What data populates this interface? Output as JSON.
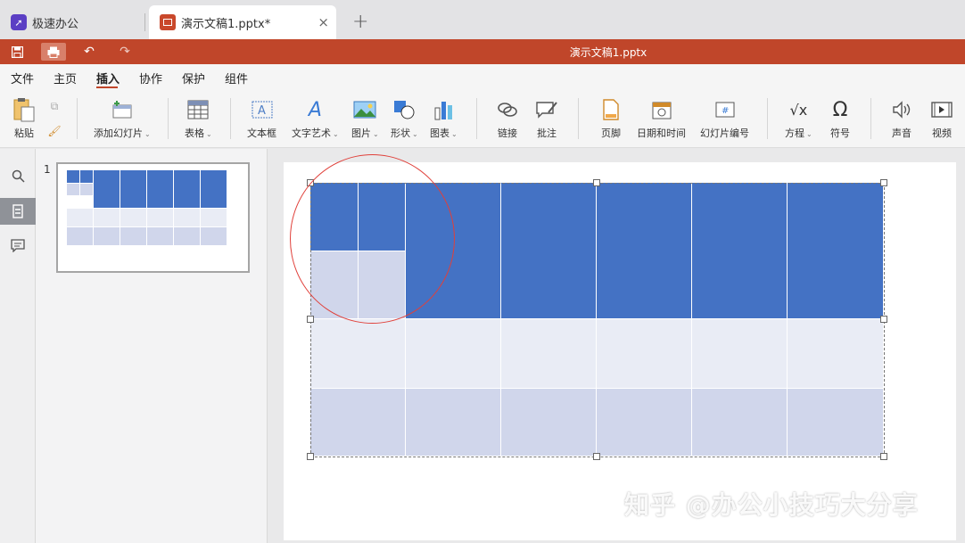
{
  "tabs": {
    "app_label": "极速办公",
    "doc_label": "演示文稿1.pptx*",
    "close_glyph": "×",
    "new_glyph": "+"
  },
  "titlebar": {
    "title": "演示文稿1.pptx"
  },
  "menu": {
    "items": [
      "文件",
      "主页",
      "插入",
      "协作",
      "保护",
      "组件"
    ],
    "active": "插入"
  },
  "ribbon": {
    "paste": "粘贴",
    "add_slide": "添加幻灯片",
    "table": "表格",
    "textbox": "文本框",
    "textart": "文字艺术",
    "picture": "图片",
    "shape": "形状",
    "chart": "图表",
    "link": "链接",
    "comment": "批注",
    "footer": "页脚",
    "datetime": "日期和时间",
    "slide_number": "幻灯片编号",
    "equation": "方程",
    "symbol": "符号",
    "audio": "声音",
    "video": "视频"
  },
  "slides_panel": {
    "slide_number": "1"
  },
  "colors": {
    "brand": "#c0462a",
    "table_header": "#4472c4",
    "table_light": "#e9ecf5",
    "table_mid": "#d0d6eb"
  },
  "watermark": "知乎 @办公小技巧大分享"
}
